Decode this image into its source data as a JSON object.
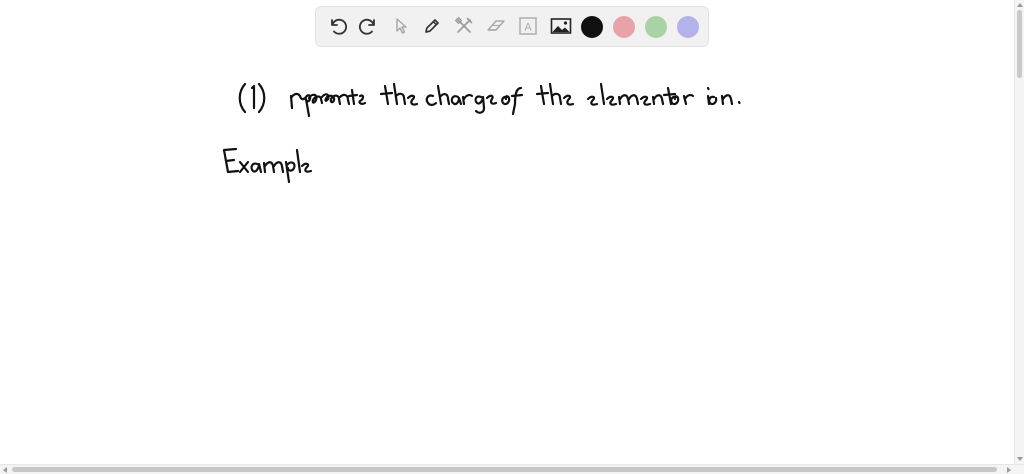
{
  "toolbar": {
    "tools": [
      {
        "name": "undo-icon",
        "interactable": true
      },
      {
        "name": "redo-icon",
        "interactable": true
      },
      {
        "name": "pointer-icon",
        "interactable": true
      },
      {
        "name": "pen-icon",
        "interactable": true
      },
      {
        "name": "tools-icon",
        "interactable": true
      },
      {
        "name": "eraser-icon",
        "interactable": true
      },
      {
        "name": "text-icon",
        "interactable": true
      },
      {
        "name": "image-icon",
        "interactable": true
      }
    ],
    "colors": {
      "black": "#111111",
      "red": "#e8a3a8",
      "green": "#a9d3a4",
      "purple": "#b4b2ea"
    },
    "text_tool_glyph": "A"
  },
  "whiteboard": {
    "line1": "(1) represents the charge of the element or ion.",
    "line2": "Example"
  }
}
